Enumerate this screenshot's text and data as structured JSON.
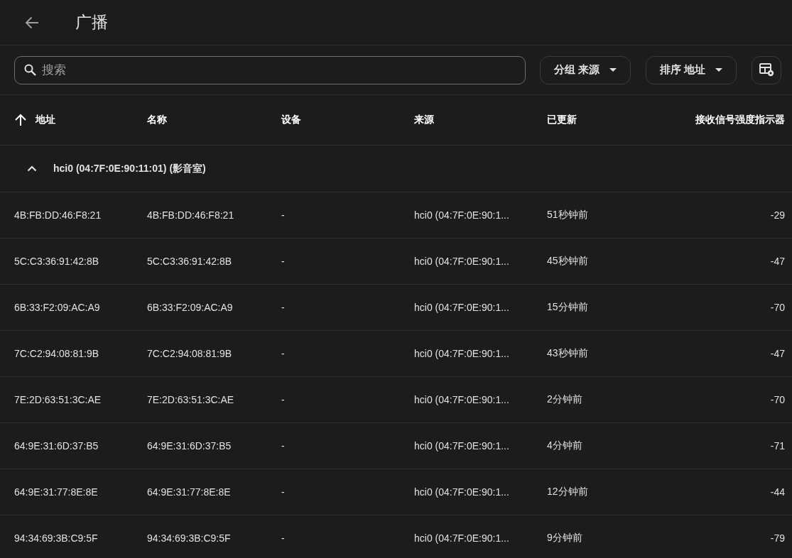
{
  "header": {
    "title": "广播"
  },
  "toolbar": {
    "search": {
      "placeholder": "搜索"
    },
    "group_button": {
      "label": "分组 来源"
    },
    "sort_button": {
      "label": "排序 地址"
    }
  },
  "table": {
    "columns": [
      {
        "label": "地址",
        "sorted": true
      },
      {
        "label": "名称",
        "sorted": false
      },
      {
        "label": "设备",
        "sorted": false
      },
      {
        "label": "来源",
        "sorted": false
      },
      {
        "label": "已更新",
        "sorted": false
      },
      {
        "label": "接收信号强度指示器",
        "sorted": false
      }
    ],
    "groups": [
      {
        "label": "hci0 (04:7F:0E:90:11:01) (影音室)",
        "expanded": true,
        "rows": [
          {
            "cells": [
              "4B:FB:DD:46:F8:21",
              "4B:FB:DD:46:F8:21",
              "-",
              "hci0 (04:7F:0E:90:1...",
              "51秒钟前",
              "-29"
            ]
          },
          {
            "cells": [
              "5C:C3:36:91:42:8B",
              "5C:C3:36:91:42:8B",
              "-",
              "hci0 (04:7F:0E:90:1...",
              "45秒钟前",
              "-47"
            ]
          },
          {
            "cells": [
              "6B:33:F2:09:AC:A9",
              "6B:33:F2:09:AC:A9",
              "-",
              "hci0 (04:7F:0E:90:1...",
              "15分钟前",
              "-70"
            ]
          },
          {
            "cells": [
              "7C:C2:94:08:81:9B",
              "7C:C2:94:08:81:9B",
              "-",
              "hci0 (04:7F:0E:90:1...",
              "43秒钟前",
              "-47"
            ]
          },
          {
            "cells": [
              "7E:2D:63:51:3C:AE",
              "7E:2D:63:51:3C:AE",
              "-",
              "hci0 (04:7F:0E:90:1...",
              "2分钟前",
              "-70"
            ]
          },
          {
            "cells": [
              "64:9E:31:6D:37:B5",
              "64:9E:31:6D:37:B5",
              "-",
              "hci0 (04:7F:0E:90:1...",
              "4分钟前",
              "-71"
            ]
          },
          {
            "cells": [
              "64:9E:31:77:8E:8E",
              "64:9E:31:77:8E:8E",
              "-",
              "hci0 (04:7F:0E:90:1...",
              "12分钟前",
              "-44"
            ]
          },
          {
            "cells": [
              "94:34:69:3B:C9:5F",
              "94:34:69:3B:C9:5F",
              "-",
              "hci0 (04:7F:0E:90:1...",
              "9分钟前",
              "-79"
            ]
          }
        ]
      }
    ]
  }
}
